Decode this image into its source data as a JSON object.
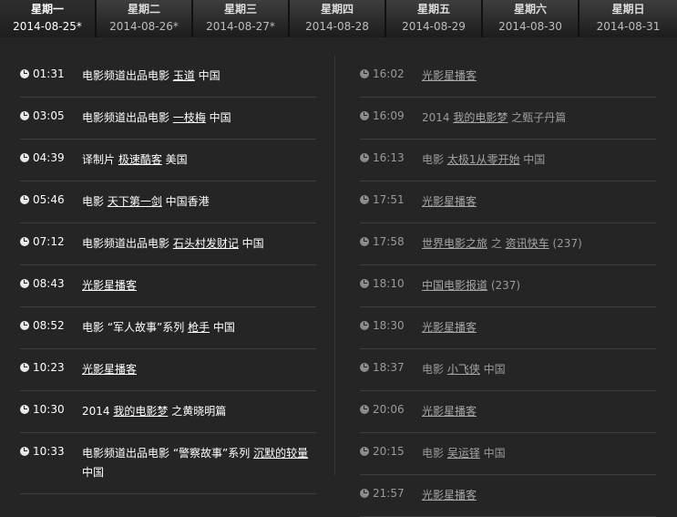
{
  "tabs": [
    {
      "day": "星期一",
      "date": "2014-08-25*",
      "active": true
    },
    {
      "day": "星期二",
      "date": "2014-08-26*",
      "active": false
    },
    {
      "day": "星期三",
      "date": "2014-08-27*",
      "active": false
    },
    {
      "day": "星期四",
      "date": "2014-08-28",
      "active": false
    },
    {
      "day": "星期五",
      "date": "2014-08-29",
      "active": false
    },
    {
      "day": "星期六",
      "date": "2014-08-30",
      "active": false
    },
    {
      "day": "星期日",
      "date": "2014-08-31",
      "active": false
    }
  ],
  "schedule": {
    "left": [
      {
        "time": "01:31",
        "parts": [
          {
            "t": "电影频道出品电影 "
          },
          {
            "t": "玉道",
            "link": true
          },
          {
            "t": " 中国"
          }
        ]
      },
      {
        "time": "03:05",
        "parts": [
          {
            "t": "电影频道出品电影 "
          },
          {
            "t": "一枝梅",
            "link": true
          },
          {
            "t": " 中国"
          }
        ]
      },
      {
        "time": "04:39",
        "parts": [
          {
            "t": "译制片 "
          },
          {
            "t": "极速酷客",
            "link": true
          },
          {
            "t": " 美国"
          }
        ]
      },
      {
        "time": "05:46",
        "parts": [
          {
            "t": "电影 "
          },
          {
            "t": "天下第一剑",
            "link": true
          },
          {
            "t": " 中国香港"
          }
        ]
      },
      {
        "time": "07:12",
        "parts": [
          {
            "t": "电影频道出品电影 "
          },
          {
            "t": "石头村发财记",
            "link": true
          },
          {
            "t": " 中国"
          }
        ]
      },
      {
        "time": "08:43",
        "parts": [
          {
            "t": "光影星播客",
            "link": true
          }
        ]
      },
      {
        "time": "08:52",
        "parts": [
          {
            "t": "电影 “军人故事”系列 "
          },
          {
            "t": "枪手",
            "link": true
          },
          {
            "t": " 中国"
          }
        ]
      },
      {
        "time": "10:23",
        "parts": [
          {
            "t": "光影星播客",
            "link": true
          }
        ]
      },
      {
        "time": "10:30",
        "parts": [
          {
            "t": "2014 "
          },
          {
            "t": "我的电影梦",
            "link": true
          },
          {
            "t": " 之黄晓明篇"
          }
        ]
      },
      {
        "time": "10:33",
        "parts": [
          {
            "t": "电影频道出品电影 “警察故事”系列 "
          },
          {
            "t": "沉默的较量",
            "link": true
          },
          {
            "t": " 中国"
          }
        ]
      }
    ],
    "right": [
      {
        "time": "16:02",
        "parts": [
          {
            "t": "光影星播客",
            "link": true
          }
        ]
      },
      {
        "time": "16:09",
        "parts": [
          {
            "t": "2014 "
          },
          {
            "t": "我的电影梦",
            "link": true
          },
          {
            "t": " 之甄子丹篇"
          }
        ]
      },
      {
        "time": "16:13",
        "parts": [
          {
            "t": "电影 "
          },
          {
            "t": "太极1从零开始",
            "link": true
          },
          {
            "t": " 中国"
          }
        ]
      },
      {
        "time": "17:51",
        "parts": [
          {
            "t": "光影星播客",
            "link": true
          }
        ]
      },
      {
        "time": "17:58",
        "parts": [
          {
            "t": "世界电影之旅",
            "link": true
          },
          {
            "t": " 之 "
          },
          {
            "t": "资讯快车",
            "link": true
          },
          {
            "t": " (237)"
          }
        ]
      },
      {
        "time": "18:10",
        "parts": [
          {
            "t": "中国电影报道",
            "link": true
          },
          {
            "t": " (237)"
          }
        ]
      },
      {
        "time": "18:30",
        "parts": [
          {
            "t": "光影星播客",
            "link": true
          }
        ]
      },
      {
        "time": "18:37",
        "parts": [
          {
            "t": "电影 "
          },
          {
            "t": "小飞侠",
            "link": true
          },
          {
            "t": " 中国"
          }
        ]
      },
      {
        "time": "20:06",
        "parts": [
          {
            "t": "光影星播客",
            "link": true
          }
        ]
      },
      {
        "time": "20:15",
        "parts": [
          {
            "t": "电影 "
          },
          {
            "t": "吴运铎",
            "link": true
          },
          {
            "t": " 中国"
          }
        ]
      },
      {
        "time": "21:57",
        "parts": [
          {
            "t": "光影星播客",
            "link": true
          }
        ]
      }
    ]
  }
}
